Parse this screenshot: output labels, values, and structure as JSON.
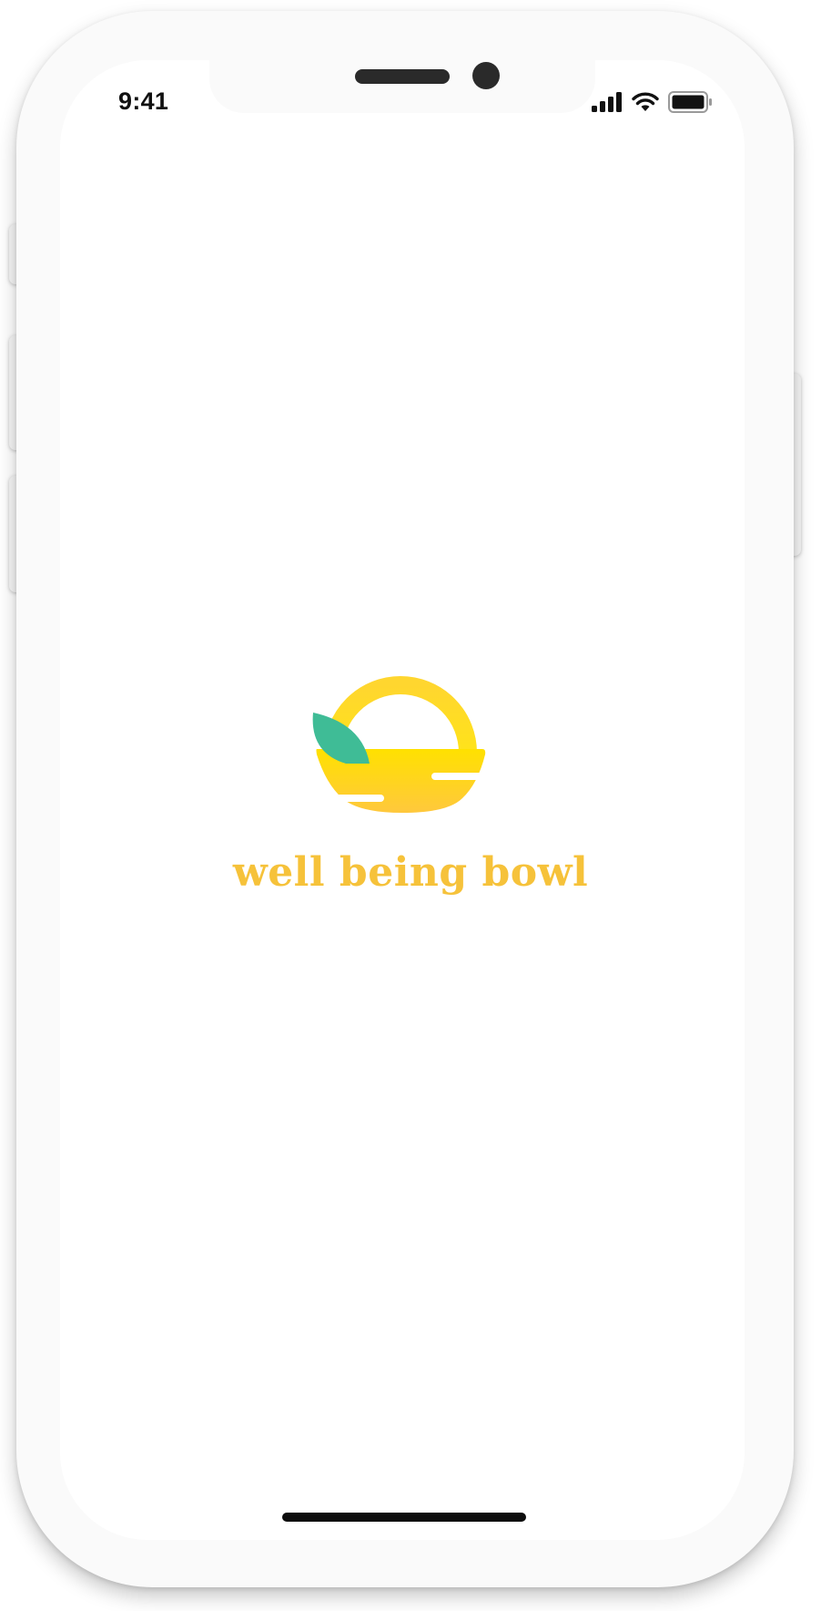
{
  "status_bar": {
    "time": "9:41",
    "icons": [
      "cellular-signal-icon",
      "wifi-icon",
      "battery-icon"
    ]
  },
  "splash": {
    "logo_icon": "bowl-with-leaf-logo",
    "brand_name": "well being bowl"
  },
  "colors": {
    "brand_text": "#f6c23a",
    "bowl_top": "#ffe100",
    "bowl_bottom": "#ffc83d",
    "leaf": "#3fbc96",
    "home_indicator": "#0c0c0c"
  }
}
